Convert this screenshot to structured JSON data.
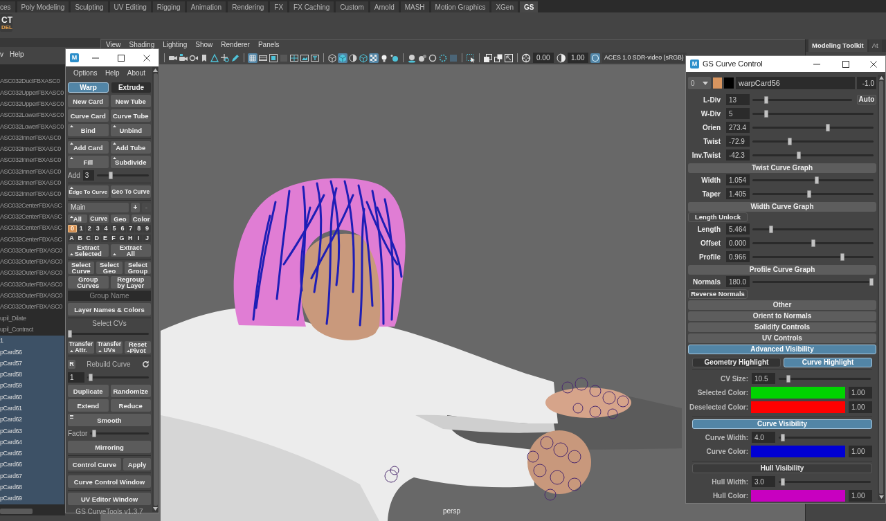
{
  "shelf_tabs": [
    {
      "label": "ces",
      "selected": false
    },
    {
      "label": "Poly Modeling",
      "selected": false
    },
    {
      "label": "Sculpting",
      "selected": false
    },
    {
      "label": "UV Editing",
      "selected": false
    },
    {
      "label": "Rigging",
      "selected": false
    },
    {
      "label": "Animation",
      "selected": false
    },
    {
      "label": "Rendering",
      "selected": false
    },
    {
      "label": "FX",
      "selected": false
    },
    {
      "label": "FX Caching",
      "selected": false
    },
    {
      "label": "Custom",
      "selected": false
    },
    {
      "label": "Arnold",
      "selected": false
    },
    {
      "label": "MASH",
      "selected": false
    },
    {
      "label": "Motion Graphics",
      "selected": false
    },
    {
      "label": "XGen",
      "selected": false
    },
    {
      "label": "GS",
      "selected": true
    }
  ],
  "shelf": {
    "buttons": [
      {
        "lines": [
          "CT",
          "DEL"
        ]
      }
    ]
  },
  "outliner": {
    "menu": [
      "v",
      "Help"
    ],
    "rows": [
      {
        "label": "ASC032DuctFBXASC0",
        "selected": false
      },
      {
        "label": "ASC032UpperFBXASC0",
        "selected": false
      },
      {
        "label": "ASC032UpperFBXASC0",
        "selected": false
      },
      {
        "label": "ASC032LowerFBXASC0",
        "selected": false
      },
      {
        "label": "ASC032LowerFBXASC0",
        "selected": false
      },
      {
        "label": "ASC032InnerFBXASC0",
        "selected": false
      },
      {
        "label": "ASC032InnerFBXASC0",
        "selected": false
      },
      {
        "label": "ASC032InnerFBXASC0",
        "selected": false
      },
      {
        "label": "ASC032InnerFBXASC0",
        "selected": false
      },
      {
        "label": "ASC032InnerFBXASC0",
        "selected": false
      },
      {
        "label": "ASC032InnerFBXASC0",
        "selected": false
      },
      {
        "label": "ASC032CenterFBXASC",
        "selected": false
      },
      {
        "label": "ASC032CenterFBXASC",
        "selected": false
      },
      {
        "label": "ASC032CenterFBXASC",
        "selected": false
      },
      {
        "label": "ASC032CenterFBXASC",
        "selected": false
      },
      {
        "label": "ASC032OuterFBXASC0",
        "selected": false
      },
      {
        "label": "ASC032OuterFBXASC0",
        "selected": false
      },
      {
        "label": "ASC032OuterFBXASC0",
        "selected": false
      },
      {
        "label": "ASC032OuterFBXASC0",
        "selected": false
      },
      {
        "label": "ASC032OuterFBXASC0",
        "selected": false
      },
      {
        "label": "ASC032OuterFBXASC0",
        "selected": false
      },
      {
        "label": "upil_Dilate",
        "selected": false
      },
      {
        "label": "upil_Contract",
        "selected": false
      },
      {
        "label": "1",
        "selected": true
      },
      {
        "label": "pCard56",
        "selected": true
      },
      {
        "label": "pCard57",
        "selected": true
      },
      {
        "label": "pCard58",
        "selected": true
      },
      {
        "label": "pCard59",
        "selected": true
      },
      {
        "label": "pCard60",
        "selected": true
      },
      {
        "label": "pCard61",
        "selected": true
      },
      {
        "label": "pCard62",
        "selected": true
      },
      {
        "label": "pCard63",
        "selected": true
      },
      {
        "label": "pCard64",
        "selected": true
      },
      {
        "label": "pCard65",
        "selected": true
      },
      {
        "label": "pCard66",
        "selected": true
      },
      {
        "label": "pCard67",
        "selected": true
      },
      {
        "label": "pCard68",
        "selected": true
      },
      {
        "label": "pCard69",
        "selected": true
      }
    ]
  },
  "viewport": {
    "menu": [
      "View",
      "Shading",
      "Lighting",
      "Show",
      "Renderer",
      "Panels"
    ],
    "toolbar_groups": [
      [
        {
          "on": false
        },
        {
          "on": false
        },
        {
          "on": false
        },
        {
          "on": false
        },
        {
          "on": false
        },
        {
          "on": false
        },
        {
          "on": false
        }
      ],
      [
        {
          "on": true
        },
        {
          "on": false
        },
        {
          "on": false
        },
        {
          "on": false
        },
        {
          "on": false
        },
        {
          "on": false
        },
        {
          "on": false
        }
      ],
      [
        {
          "on": false
        },
        {
          "on": true
        },
        {
          "on": false
        },
        {
          "on": false
        },
        {
          "on": true
        },
        {
          "on": false
        },
        {
          "on": false
        }
      ],
      [
        {
          "on": false
        },
        {
          "on": false
        },
        {
          "on": false
        },
        {
          "on": false
        },
        {
          "on": false
        }
      ],
      [
        {
          "on": false
        }
      ],
      [
        {
          "on": false
        },
        {
          "on": false
        },
        {
          "on": false
        }
      ]
    ],
    "exposure": "0.00",
    "gamma": "1.00",
    "color_management": {
      "on": true
    },
    "view_transform": "ACES 1.0 SDR-video (sRGB)",
    "camera": "persp"
  },
  "side_panel": {
    "tabs": [
      {
        "label": "Modeling Toolkit",
        "selected": true
      },
      {
        "label": "At",
        "selected": false
      }
    ]
  },
  "curve_tools_window": {
    "logo": "M",
    "rows": [
      {
        "kind": "menu",
        "items": [
          "Options",
          "Help",
          "About"
        ]
      },
      {
        "kind": "toggle",
        "buttons": [
          {
            "label": "Warp",
            "selected": true
          },
          {
            "label": "Extrude",
            "selected": false
          }
        ]
      },
      {
        "kind": "buttons",
        "buttons": [
          {
            "label": "New Card",
            "mark": false
          },
          {
            "label": "New Tube",
            "mark": false
          }
        ]
      },
      {
        "kind": "buttons",
        "buttons": [
          {
            "label": "Curve Card",
            "mark": false
          },
          {
            "label": "Curve Tube",
            "mark": false
          }
        ]
      },
      {
        "kind": "buttons",
        "buttons": [
          {
            "label": "Bind",
            "mark": true
          },
          {
            "label": "Unbind",
            "mark": true
          }
        ]
      },
      {
        "kind": "separator"
      },
      {
        "kind": "buttons",
        "buttons": [
          {
            "label": "Add Card",
            "mark": true
          },
          {
            "label": "Add Tube",
            "mark": true
          }
        ]
      },
      {
        "kind": "buttons",
        "buttons": [
          {
            "label": "Fill",
            "mark": true
          },
          {
            "label": "Subdivide",
            "mark": true
          }
        ]
      },
      {
        "kind": "slider",
        "label": "Add",
        "value": "3",
        "level": 0.25
      },
      {
        "kind": "separator"
      },
      {
        "kind": "buttons",
        "buttons": [
          {
            "label": "Edge To Curve",
            "mark": true
          },
          {
            "label": "Geo To Curve",
            "mark": false
          }
        ]
      },
      {
        "kind": "separator"
      },
      {
        "kind": "layer_set",
        "value": "Main",
        "buttons": [
          {
            "label": "+",
            "disabled": false
          },
          {
            "label": "-",
            "disabled": true
          }
        ]
      },
      {
        "kind": "filters",
        "buttons": [
          {
            "label": "All",
            "mark": true
          },
          {
            "label": "Curve",
            "mark": false
          },
          {
            "label": "Geo",
            "mark": false
          },
          {
            "label": "Color",
            "mark": false
          }
        ]
      },
      {
        "kind": "layers",
        "buttons": [
          {
            "label": "0",
            "selected": true
          },
          {
            "label": "1",
            "selected": false
          },
          {
            "label": "2",
            "selected": false
          },
          {
            "label": "3",
            "selected": false
          },
          {
            "label": "4",
            "selected": false
          },
          {
            "label": "5",
            "selected": false
          },
          {
            "label": "6",
            "selected": false
          },
          {
            "label": "7",
            "selected": false
          },
          {
            "label": "8",
            "selected": false
          },
          {
            "label": "9",
            "selected": false
          }
        ]
      },
      {
        "kind": "layers",
        "buttons": [
          {
            "label": "A",
            "selected": false
          },
          {
            "label": "B",
            "selected": false
          },
          {
            "label": "C",
            "selected": false
          },
          {
            "label": "D",
            "selected": false
          },
          {
            "label": "E",
            "selected": false
          },
          {
            "label": "F",
            "selected": false
          },
          {
            "label": "G",
            "selected": false
          },
          {
            "label": "H",
            "selected": false
          },
          {
            "label": "I",
            "selected": false
          },
          {
            "label": "J",
            "selected": false
          }
        ]
      },
      {
        "kind": "tall_buttons",
        "buttons": [
          {
            "label": "Extract\nSelected",
            "mark": true
          },
          {
            "label": "Extract\nAll",
            "mark": true
          }
        ]
      },
      {
        "kind": "separator"
      },
      {
        "kind": "buttons",
        "buttons": [
          {
            "label": "Select\nCurve",
            "mark": false
          },
          {
            "label": "Select\nGeo",
            "mark": false
          },
          {
            "label": "Select\nGroup",
            "mark": false
          }
        ]
      },
      {
        "kind": "buttons",
        "buttons": [
          {
            "label": "Group\nCurves",
            "mark": false
          },
          {
            "label": "Regroup\nby Layer",
            "mark": false
          }
        ]
      },
      {
        "kind": "field",
        "placeholder": "Group Name"
      },
      {
        "kind": "buttons",
        "buttons": [
          {
            "label": "Layer Names & Colors",
            "mark": false
          }
        ]
      },
      {
        "kind": "separator"
      },
      {
        "kind": "label",
        "text": "Select CVs"
      },
      {
        "kind": "slider",
        "level": 0
      },
      {
        "kind": "tall_buttons",
        "buttons": [
          {
            "label": "Transfer\nAttr.",
            "mark": true
          },
          {
            "label": "Transfer\nUVs",
            "mark": true
          },
          {
            "label": "Reset\nPivot",
            "mark": true
          }
        ]
      },
      {
        "kind": "separator"
      },
      {
        "kind": "rebuild",
        "button": "R",
        "label": "Rebuild Curve"
      },
      {
        "kind": "slider",
        "value": "1",
        "level": 0.03
      },
      {
        "kind": "buttons",
        "buttons": [
          {
            "label": "Duplicate",
            "mark": false
          },
          {
            "label": "Randomize",
            "mark": false
          }
        ]
      },
      {
        "kind": "buttons",
        "buttons": [
          {
            "label": "Extend",
            "mark": false
          },
          {
            "label": "Reduce",
            "mark": false
          }
        ]
      },
      {
        "kind": "menu_button",
        "buttons": [
          {
            "label": "Smooth",
            "mark": true
          }
        ]
      },
      {
        "kind": "slider",
        "label": "Factor",
        "level": 0.03
      },
      {
        "kind": "buttons",
        "buttons": [
          {
            "label": "Mirroring",
            "mark": false
          }
        ]
      },
      {
        "kind": "separator"
      },
      {
        "kind": "split",
        "buttons": [
          {
            "label": "Control Curve",
            "mark": false
          },
          {
            "label": "Apply",
            "mark": false
          }
        ]
      },
      {
        "kind": "separator"
      },
      {
        "kind": "buttons",
        "buttons": [
          {
            "label": "Curve Control Window",
            "mark": false
          }
        ]
      },
      {
        "kind": "separator"
      },
      {
        "kind": "buttons",
        "buttons": [
          {
            "label": "UV Editor Window",
            "mark": false
          }
        ]
      },
      {
        "kind": "footer",
        "text": "GS CurveTools v1.3.7"
      }
    ]
  },
  "curve_control_window": {
    "logo": "M",
    "title": "GS Curve Control",
    "rows": [
      {
        "kind": "card",
        "layer": "0",
        "swatches": [
          {
            "color": "#d8955f"
          },
          {
            "color": "#000000"
          }
        ],
        "name": "warpCard56",
        "value": "-1.0"
      },
      {
        "kind": "slider",
        "label": "L-Div",
        "value": "13",
        "level": 0.12,
        "button": "Auto"
      },
      {
        "kind": "slider",
        "label": "W-Div",
        "value": "5",
        "level": 0.1
      },
      {
        "kind": "slider",
        "label": "Orien",
        "value": "273.4",
        "level": 0.63
      },
      {
        "kind": "slider",
        "label": "Twist",
        "value": "-72.9",
        "level": 0.3
      },
      {
        "kind": "slider",
        "label": "Inv.Twist",
        "value": "-42.3",
        "level": 0.38
      },
      {
        "kind": "section",
        "label": "Twist Curve Graph"
      },
      {
        "kind": "slider",
        "label": "Width",
        "value": "1.054",
        "level": 0.53
      },
      {
        "kind": "slider",
        "label": "Taper",
        "value": "1.405",
        "level": 0.47
      },
      {
        "kind": "section",
        "label": "Width Curve Graph"
      },
      {
        "kind": "button",
        "label": "Length Unlock"
      },
      {
        "kind": "slider",
        "label": "Length",
        "value": "5.464",
        "level": 0.14
      },
      {
        "kind": "slider",
        "label": "Offset",
        "value": "0.000",
        "level": 0.5
      },
      {
        "kind": "slider",
        "label": "Profile",
        "value": "0.966",
        "level": 0.75
      },
      {
        "kind": "section",
        "label": "Profile Curve Graph"
      },
      {
        "kind": "slider",
        "label": "Normals",
        "value": "180.0",
        "level": 1
      },
      {
        "kind": "button",
        "label": "Reverse Normals"
      },
      {
        "kind": "section",
        "label": "Other"
      },
      {
        "kind": "section",
        "label": "Orient to Normals"
      },
      {
        "kind": "section",
        "label": "Solidify Controls"
      },
      {
        "kind": "section",
        "label": "UV Controls"
      },
      {
        "kind": "toggle_bar",
        "label": "Advanced Visibility",
        "on": true
      },
      {
        "kind": "tabs",
        "tabs": [
          {
            "label": "Geometry Highlight",
            "selected": false
          },
          {
            "label": "Curve Highlight",
            "selected": true
          }
        ]
      },
      {
        "kind": "rule"
      },
      {
        "kind": "setting_slider",
        "label": "CV Size:",
        "value": "10.5",
        "level": 0.09
      },
      {
        "kind": "setting_color",
        "label": "Selected Color:",
        "color": "#00d400",
        "value": "1.00"
      },
      {
        "kind": "setting_color",
        "label": "Deselected Color:",
        "color": "#ff0000",
        "value": "1.00"
      },
      {
        "kind": "rule"
      },
      {
        "kind": "toggle_subbar",
        "label": "Curve Visibility",
        "on": true
      },
      {
        "kind": "setting_slider",
        "label": "Curve Width:",
        "value": "4.0",
        "level": 0.02
      },
      {
        "kind": "setting_color",
        "label": "Curve Color:",
        "color": "#0000d4",
        "value": "1.00"
      },
      {
        "kind": "rule"
      },
      {
        "kind": "toggle_subbar",
        "label": "Hull Visibility",
        "on": false
      },
      {
        "kind": "setting_slider",
        "label": "Hull Width:",
        "value": "3.0",
        "level": 0.02
      },
      {
        "kind": "setting_color",
        "label": "Hull Color:",
        "color": "#c800c0",
        "value": "1.00"
      }
    ]
  }
}
